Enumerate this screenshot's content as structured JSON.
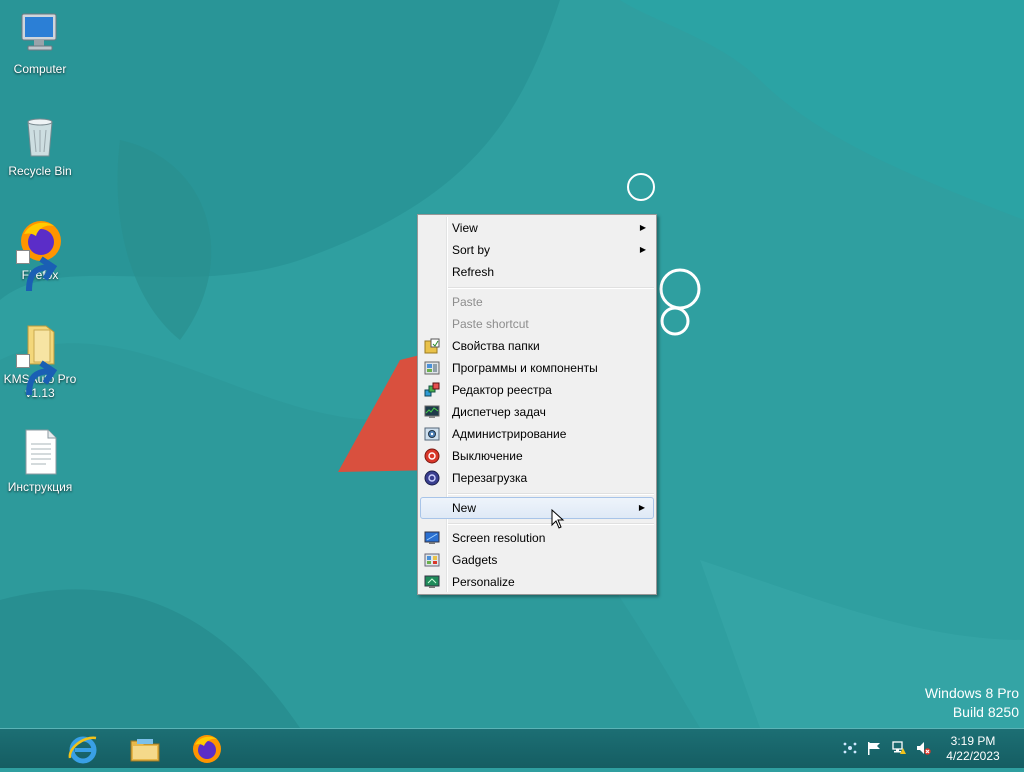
{
  "desktop": {
    "icons": [
      {
        "label": "Computer",
        "icon": "computer-icon"
      },
      {
        "label": "Recycle Bin",
        "icon": "recycle-bin-icon"
      },
      {
        "label": "Firefox",
        "icon": "firefox-icon"
      },
      {
        "label": "KMSAuto Pro v1.13",
        "icon": "folder-icon"
      },
      {
        "label": "Инструкция",
        "icon": "text-document-icon"
      }
    ]
  },
  "context_menu": {
    "items": [
      {
        "label": "View",
        "submenu": true
      },
      {
        "label": "Sort by",
        "submenu": true
      },
      {
        "label": "Refresh"
      },
      {
        "label": "Paste",
        "disabled": true
      },
      {
        "label": "Paste shortcut",
        "disabled": true
      },
      {
        "label": "Свойства папки",
        "icon": "folder-options-icon"
      },
      {
        "label": "Программы и компоненты",
        "icon": "programs-features-icon"
      },
      {
        "label": "Редактор реестра",
        "icon": "registry-editor-icon"
      },
      {
        "label": "Диспетчер задач",
        "icon": "task-manager-icon"
      },
      {
        "label": "Администрирование",
        "icon": "administrative-tools-icon"
      },
      {
        "label": "Выключение",
        "icon": "shutdown-icon"
      },
      {
        "label": "Перезагрузка",
        "icon": "restart-icon"
      },
      {
        "label": "New",
        "submenu": true,
        "highlighted": true
      },
      {
        "label": "Screen resolution",
        "icon": "screen-resolution-icon"
      },
      {
        "label": "Gadgets",
        "icon": "gadgets-icon"
      },
      {
        "label": "Personalize",
        "icon": "personalize-icon"
      }
    ]
  },
  "watermark": {
    "line1": "Windows 8 Pro",
    "line2": "Build 8250"
  },
  "taskbar": {
    "pinned": [
      "internet-explorer-icon",
      "file-explorer-icon",
      "firefox-icon"
    ],
    "tray": [
      "network-status-icon",
      "action-center-flag-icon",
      "network-icon",
      "volume-muted-icon"
    ],
    "clock": {
      "time": "3:19 PM",
      "date": "4/22/2023"
    }
  },
  "colors": {
    "desktop_bg": "#2f9fa0",
    "menu_bg": "#f0f0f0",
    "taskbar_bg": "#176468"
  }
}
